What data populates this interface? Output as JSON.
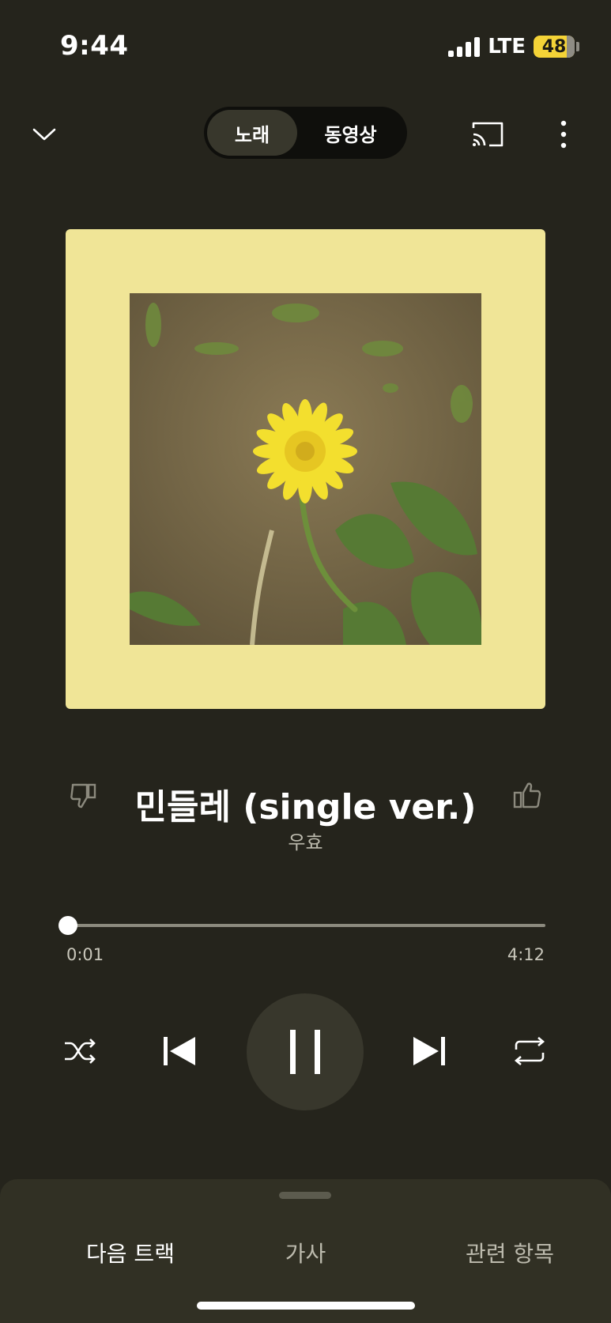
{
  "status_bar": {
    "time": "9:44",
    "network": "LTE",
    "battery": "48"
  },
  "header": {
    "toggle_song": "노래",
    "toggle_video": "동영상",
    "collapse_icon": "chevron-down-icon",
    "cast_icon": "cast-icon",
    "more_icon": "more-vertical-icon"
  },
  "track": {
    "title": "민들레 (single ver.)",
    "artist": "우효"
  },
  "playback": {
    "elapsed": "0:01",
    "total": "4:12",
    "progress_fraction": 0.004
  },
  "controls": {
    "shuffle_icon": "shuffle-icon",
    "previous_icon": "previous-icon",
    "pause_icon": "pause-icon",
    "next_icon": "next-icon",
    "repeat_icon": "repeat-icon",
    "dislike_icon": "thumbs-down-icon",
    "like_icon": "thumbs-up-icon"
  },
  "tabs": [
    {
      "label": "다음 트랙"
    },
    {
      "label": "가사"
    },
    {
      "label": "관련 항목"
    }
  ],
  "colors": {
    "background": "#25241c",
    "album_frame": "#f0e597",
    "sheet": "#313024"
  }
}
